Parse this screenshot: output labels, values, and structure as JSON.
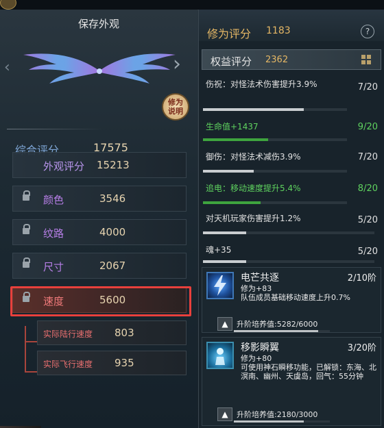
{
  "left": {
    "title": "保存外观",
    "explain_button": "修为说明",
    "total": {
      "label": "综合评分",
      "value": "17575"
    },
    "stats": [
      {
        "label": "外观评分",
        "value": "15213"
      },
      {
        "label": "颜色",
        "value": "3546"
      },
      {
        "label": "纹路",
        "value": "4000"
      },
      {
        "label": "尺寸",
        "value": "2067"
      },
      {
        "label": "速度",
        "value": "5600"
      }
    ],
    "sub_stats": [
      {
        "label": "实际陆行速度",
        "value": "803"
      },
      {
        "label": "实际飞行速度",
        "value": "935"
      }
    ]
  },
  "right": {
    "cultivation": {
      "label": "修为评分",
      "value": "1183"
    },
    "rights": {
      "label": "权益评分",
      "value": "2362"
    },
    "bonuses": [
      {
        "text": "伤祝：对怪法术伤害提升3.9%",
        "count": "7/20",
        "progress": 0.7,
        "color": "white"
      },
      {
        "text": "生命值+1437",
        "count": "9/20",
        "progress": 0.45,
        "color": "green"
      },
      {
        "text": "御伤：对怪法术减伤3.9%",
        "count": "7/20",
        "progress": 0.35,
        "color": "white"
      },
      {
        "text": "追电：移动速度提升5.4%",
        "count": "8/20",
        "progress": 0.4,
        "color": "green"
      },
      {
        "text": "对天机玩家伤害提升1.2%",
        "count": "5/20",
        "progress": 0.25,
        "color": "white"
      },
      {
        "text": "魂+35",
        "count": "5/20",
        "progress": 0.25,
        "color": "white"
      }
    ],
    "skills": [
      {
        "name": "电芒共逐",
        "level": "2/10阶",
        "desc": "修为+83\n队伍成员基础移动速度上升0.7%",
        "upgrade": "升阶培养值:5282/6000",
        "progress": 0.88
      },
      {
        "name": "移影瞬翼",
        "level": "3/20阶",
        "desc": "修为+80\n可使用神石瞬移功能，已解锁：东海、北溟南、幽州、天虞岛，回气：55分钟",
        "upgrade": "升阶培养值:2180/3000",
        "progress": 0.73
      }
    ]
  },
  "colors": {
    "highlight": "#e8403c",
    "gold": "#e5b765",
    "green": "#5fd35f",
    "purple": "#b87fe8"
  },
  "icons": [
    "arrow-left-icon",
    "arrow-right-icon",
    "wings-preview",
    "lock-icon",
    "help-icon",
    "grid-icon",
    "upgrade-arrow-icon"
  ]
}
